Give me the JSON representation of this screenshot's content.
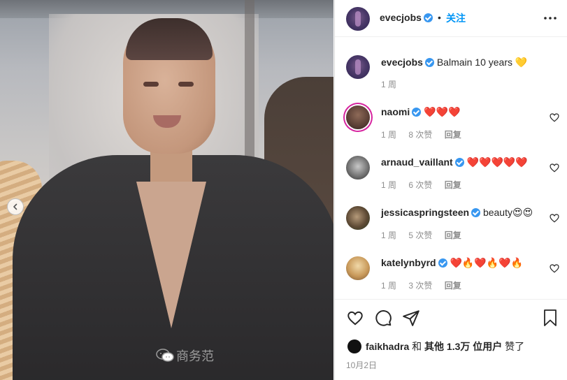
{
  "post_image": {
    "alt_hint": "photo",
    "carousel_prev_icon": "chevron-left-icon"
  },
  "header": {
    "username": "evecjobs",
    "separator": "•",
    "follow_label": "关注",
    "more_icon": "more-horizontal-icon"
  },
  "caption": {
    "username": "evecjobs",
    "text": "Balmain 10 years 💛",
    "time": "1 周"
  },
  "comments": [
    {
      "username": "naomi",
      "text": "❤️❤️❤️",
      "time": "1 周",
      "likes": "8 次赞",
      "reply": "回复"
    },
    {
      "username": "arnaud_vaillant",
      "text": "❤️❤️❤️❤️❤️",
      "time": "1 周",
      "likes": "6 次赞",
      "reply": "回复"
    },
    {
      "username": "jessicaspringsteen",
      "text": "beauty😍😍",
      "time": "1 周",
      "likes": "5 次赞",
      "reply": "回复"
    },
    {
      "username": "katelynbyrd",
      "text": "❤️🔥❤️🔥❤️🔥",
      "time": "1 周",
      "likes": "3 次赞",
      "reply": "回复"
    }
  ],
  "actions": {
    "like_icon": "heart-icon",
    "comment_icon": "comment-icon",
    "share_icon": "send-icon",
    "save_icon": "bookmark-icon"
  },
  "likes": {
    "username": "faikhadra",
    "connector": "和",
    "others": "其他 1.3万 位用户",
    "suffix": "赞了"
  },
  "date": "10月2日",
  "watermark": "商务范",
  "colors": {
    "link_blue": "#0095f6",
    "verified_blue": "#3897f0",
    "muted": "#8e8e8e"
  }
}
